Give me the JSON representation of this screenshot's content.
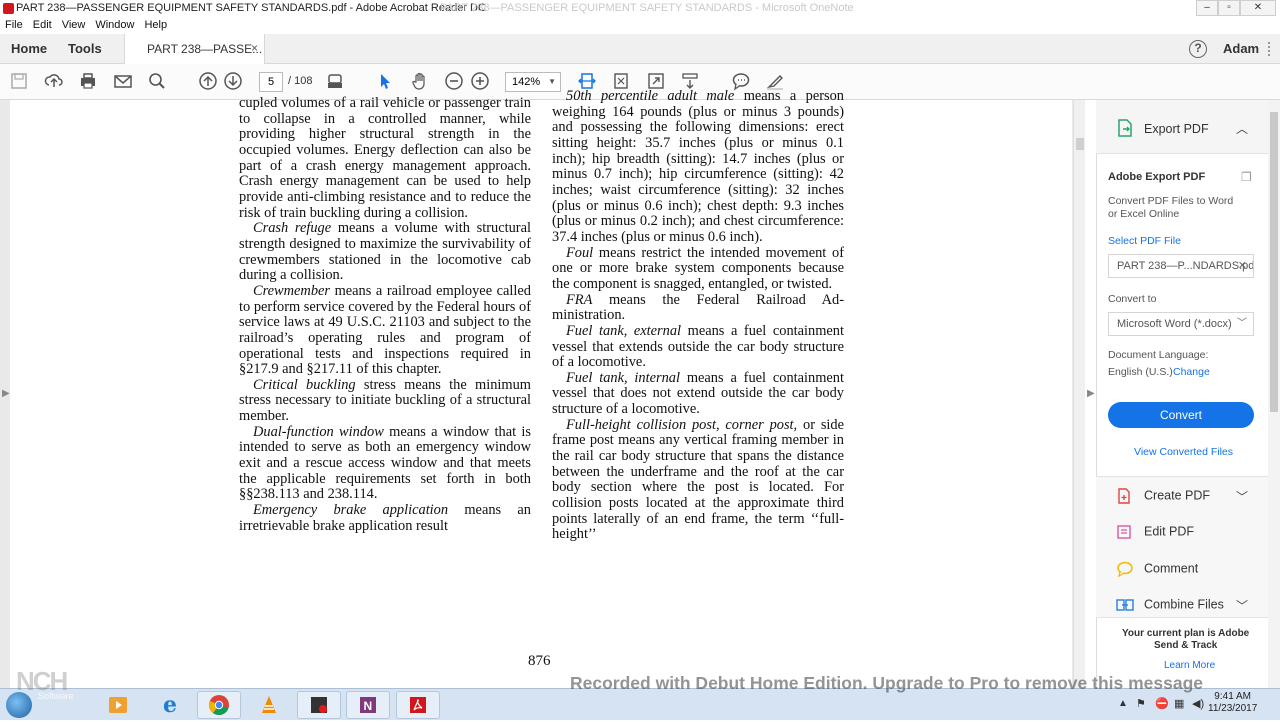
{
  "window": {
    "title": "PART 238—PASSENGER EQUIPMENT SAFETY STANDARDS.pdf - Adobe Acrobat Reader DC",
    "ghost_title": "PART 238—PASSENGER EQUIPMENT SAFETY STANDARDS - Microsoft OneNote"
  },
  "menu": [
    "File",
    "Edit",
    "View",
    "Window",
    "Help"
  ],
  "tabs": {
    "home": "Home",
    "tools": "Tools",
    "document": "PART 238—PASSE...",
    "close": "×",
    "user": "Adam",
    "help": "?"
  },
  "toolbar": {
    "page_current": "5",
    "page_total": "/ 108",
    "zoom": "142%"
  },
  "document": {
    "page_number": "876",
    "col1_html": "<p class=\"noind\">cupled volumes of a rail vehicle or pas­senger train to collapse in a controlled manner, while providing higher struc­tural strength in the occupied volumes. Energy deflection can also be part of a crash energy management approach. Crash energy management can be used to help provide anti-climbing resist­ance and to reduce the risk of train buckling during a collision.</p><p><i>Crash refuge</i> means a volume with structural strength designed to maxi­mize the survivability of crewmembers stationed in the locomotive cab during a collision.</p><p><i>Crewmember</i> means a railroad em­ployee called to perform service cov­ered by the Federal hours of service laws at 49 U.S.C. 21103 and subject to the railroad’s operating rules and pro­gram of operational tests and inspec­tions required in §217.9 and §217.11 of this chapter.</p><p><i>Critical buckling</i> stress means the minimum stress necessary to initiate buckling of a structural member.</p><p><i>Dual-function window</i> means a win­dow that is intended to serve as both an emergency window exit and a rescue access window and that meets the ap­plicable requirements set forth in both §§238.113 and 238.114.</p><p><i>Emergency brake application</i> means an irretrievable brake application result­</p>",
    "col2_html": "<p><i>50th percentile adult male</i> means a per­son weighing 164 pounds (plus or minus 3 pounds) and possessing the following dimensions: erect sitting height: 35.7 inches (plus or minus 0.1 inch); hip breadth (sitting): 14.7 inches (plus or minus 0.7 inch); hip circumference (sit­ting): 42 inches; waist circumference (sitting): 32 inches (plus or minus 0.6 inch); chest depth: 9.3 inches (plus or minus 0.2 inch); and chest circum­ference: 37.4 inches (plus or minus 0.6 inch).</p><p><i>Foul</i> means restrict the intended movement of one or more brake system components because the component is snagged, entangled, or twisted.</p><p><i>FRA</i> means the Federal Railroad Ad­ministration.</p><p><i>Fuel tank, external</i> means a fuel con­tainment vessel that extends outside the car body structure of a locomotive.</p><p><i>Fuel tank, internal</i> means a fuel con­tainment vessel that does not extend outside the car body structure of a lo­comotive.</p><p><i>Full-height collision post, corner post,</i> or side frame post means any vertical framing member in the rail car body structure that spans the distance be­tween the underframe and the roof at the car body section where the post is located. For collision posts located at the approximate third points laterally of an end frame, the term ‘‘full-height’’</p>"
  },
  "right_pane": {
    "export_header": "Export PDF",
    "section_title": "Adobe Export PDF",
    "description_line1": "Convert PDF Files to Word",
    "description_line2": "or Excel Online",
    "select_file_label": "Select PDF File",
    "file_name": "PART 238—P...NDARDS.pdf",
    "convert_to_label": "Convert to",
    "convert_to_value": "Microsoft Word (*.docx)",
    "language_label": "Document Language:",
    "language_value": "English (U.S.)",
    "change_link": "Change",
    "convert_button": "Convert",
    "view_converted": "View Converted Files",
    "tools": [
      "Create PDF",
      "Edit PDF",
      "Comment",
      "Combine Files"
    ],
    "plan_line1": "Your current plan is Adobe",
    "plan_line2": "Send & Track",
    "learn_more": "Learn More"
  },
  "overlay": {
    "watermark": "Recorded with Debut Home Edition. Upgrade to Pro to remove this message",
    "nch_logo": "NCH",
    "nch_sub": "Software"
  },
  "taskbar": {
    "time": "9:41 AM",
    "date": "11/23/2017"
  },
  "colors": {
    "accent": "#1473e6",
    "acrobat_red": "#d3161b"
  }
}
